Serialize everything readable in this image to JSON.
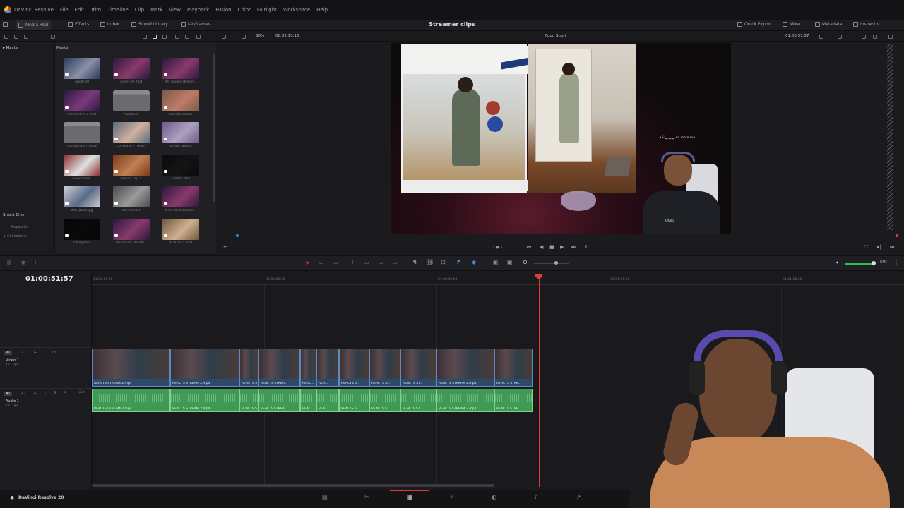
{
  "menu": {
    "app": "DaVinci Resolve",
    "items": [
      "File",
      "Edit",
      "Trim",
      "Timeline",
      "Clip",
      "Mark",
      "View",
      "Playback",
      "Fusion",
      "Color",
      "Fairlight",
      "Workspace",
      "Help"
    ]
  },
  "toolbar": {
    "media_pool": "Media Pool",
    "effects": "Effects",
    "index": "Index",
    "sound_library": "Sound Library",
    "keyframes": "Keyframes",
    "project_title": "Streamer clips",
    "quick_export": "Quick Export",
    "mixer": "Mixer",
    "metadata": "Metadata",
    "inspector": "Inspector"
  },
  "subbar": {
    "zoom": "50%",
    "source_tc": "00:02:13:15",
    "clip_name": "Food Snort",
    "record_tc": "01:00:51:57"
  },
  "sidebar": {
    "master": "Master",
    "smart_bins": "Smart Bins",
    "keywords": "Keywords",
    "collections": "Collections"
  },
  "media_pool": {
    "header": "Master",
    "items": [
      {
        "label": "Angel 69",
        "kind": "video",
        "colors": [
          "#2a3a5a",
          "#8a90a6"
        ]
      },
      {
        "label": "Angel 69.mp4",
        "kind": "video",
        "colors": [
          "#2a1840",
          "#8a3a6a"
        ]
      },
      {
        "label": "Arc Raider stream...",
        "kind": "video",
        "colors": [
          "#2a1840",
          "#8a3a6a"
        ]
      },
      {
        "label": "Arc Raiders 2.mp4",
        "kind": "video",
        "colors": [
          "#2a1840",
          "#7a3a7a"
        ]
      },
      {
        "label": "AutoSubs",
        "kind": "folder",
        "colors": [
          "#6a6a70",
          "#8a8a90"
        ]
      },
      {
        "label": "Balloon addict",
        "kind": "video",
        "colors": [
          "#7a5a4a",
          "#c07a6a"
        ]
      },
      {
        "label": "Conspiracy Theory",
        "kind": "folder",
        "colors": [
          "#6a6a70",
          "#8a8a90"
        ]
      },
      {
        "label": "Conspiracy Theory",
        "kind": "video",
        "colors": [
          "#5a6a7a",
          "#d0b0a0"
        ]
      },
      {
        "label": "Divine Sprites",
        "kind": "video",
        "colors": [
          "#6a5a8a",
          "#b0a0c0"
        ]
      },
      {
        "label": "Food Snort",
        "kind": "video",
        "colors": [
          "#8a2a2a",
          "#e0e0e0"
        ]
      },
      {
        "label": "Fusion Clip 1",
        "kind": "video",
        "colors": [
          "#7a3a1a",
          "#c08050"
        ]
      },
      {
        "label": "Grease Pole",
        "kind": "video",
        "colors": [
          "#0a0a0a",
          "#141414"
        ]
      },
      {
        "label": "IMG_0698.jpg",
        "kind": "image",
        "colors": [
          "#d0d0d0",
          "#5a6a8a"
        ]
      },
      {
        "label": "LMFAO CLIP",
        "kind": "video",
        "colors": [
          "#4a4a4a",
          "#9a9a9a"
        ]
      },
      {
        "label": "New Start stream...",
        "kind": "video",
        "colors": [
          "#2a1840",
          "#8a3a6a"
        ]
      },
      {
        "label": "Olympians",
        "kind": "video",
        "colors": [
          "#050505",
          "#0a0a0a"
        ]
      },
      {
        "label": "Peremium Stream...",
        "kind": "video",
        "colors": [
          "#2a1840",
          "#8a3a6a"
        ]
      },
      {
        "label": "REACTS 5.mp4",
        "kind": "video",
        "colors": [
          "#6a5a3a",
          "#d0b090"
        ]
      }
    ]
  },
  "viewer": {
    "chat_text": "• ii  ▁ ▁ ▁  no more me",
    "webcam_label": "Otaku"
  },
  "timeline": {
    "timecode": "01:00:51:57",
    "ruler": [
      "01:00:00:00",
      "01:00:20:00",
      "01:00:40:00",
      "01:01:00:00",
      "01:01:20:00"
    ],
    "video_track": {
      "id": "V1",
      "name": "Video 1",
      "count": "12 Clips"
    },
    "audio_track": {
      "id": "A1",
      "name": "Audio 1",
      "count": "12 Clips",
      "level": "2.0"
    },
    "clips": [
      {
        "name": "REACTS STREAM 2.mp4",
        "dur": 111
      },
      {
        "name": "REACTS STREAM 2.mp4",
        "dur": 98
      },
      {
        "name": "REACTS STREAM 2.mp4",
        "dur": 27
      },
      {
        "name": "REACTS STREA...",
        "dur": 59
      },
      {
        "name": "REAC...",
        "dur": 23
      },
      {
        "name": "REA...",
        "dur": 32
      },
      {
        "name": "REACTS 5...",
        "dur": 43
      },
      {
        "name": "REACTS S...",
        "dur": 44
      },
      {
        "name": "REACTS ST...",
        "dur": 51
      },
      {
        "name": "REACTS STREAM 2.mp4",
        "dur": 82
      },
      {
        "name": "REACTS STRE...",
        "dur": 54
      }
    ]
  },
  "pages": {
    "app_name": "DaVinci Resolve 20"
  },
  "colors": {
    "accent": "#e03a3a",
    "video_clip": "#2d4a6b",
    "audio_clip": "#3f9a55"
  }
}
